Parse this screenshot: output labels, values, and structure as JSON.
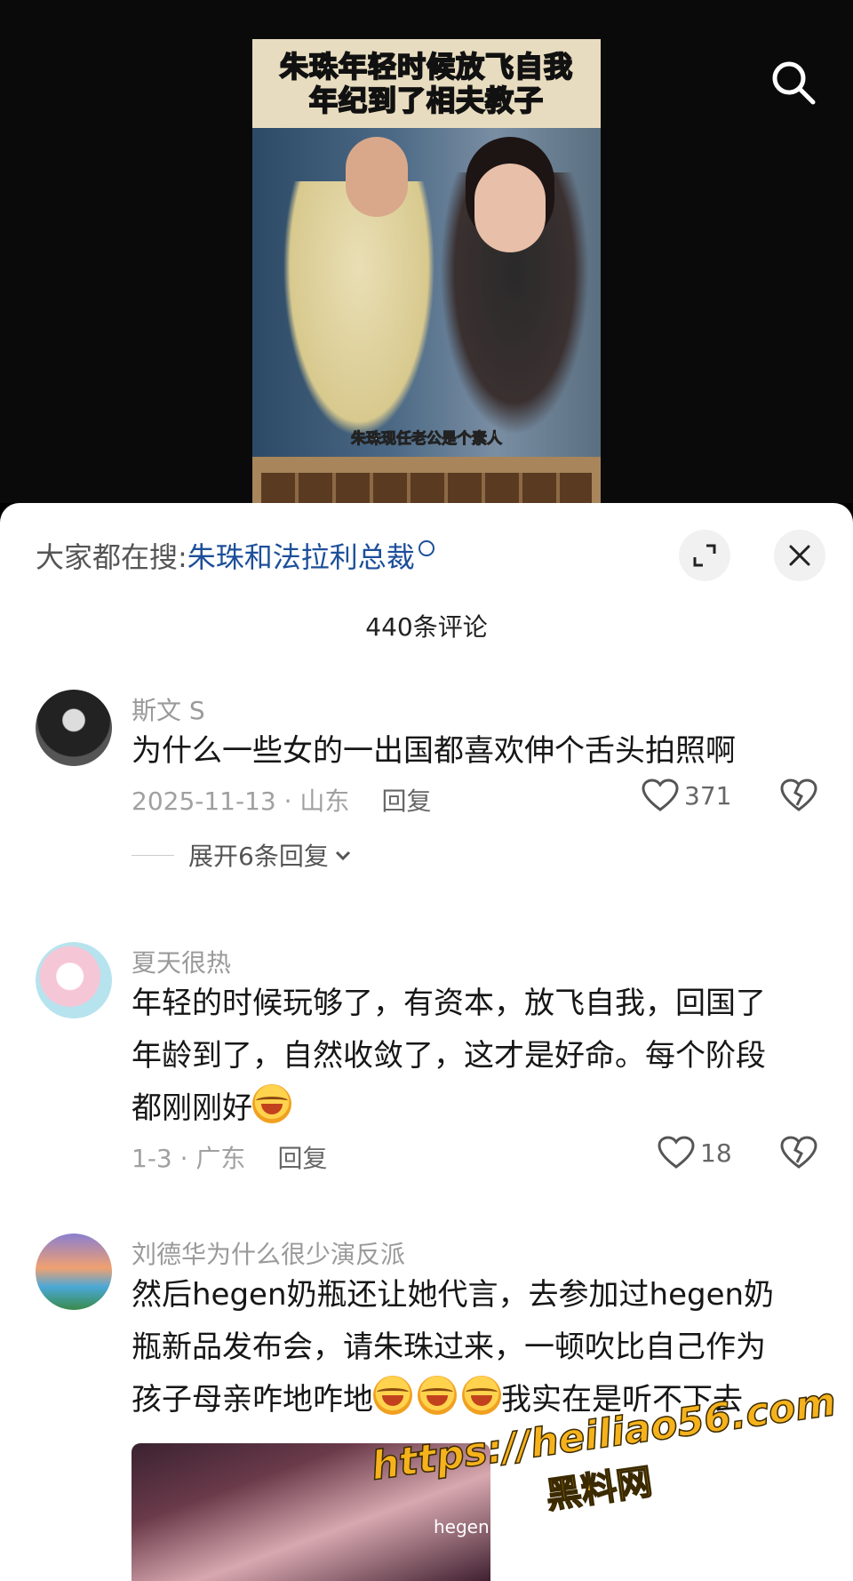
{
  "video": {
    "caption_line1": "朱珠年轻时候放飞自我",
    "caption_line2": "年纪到了相夫教子",
    "subtitle": "朱珠现任老公是个素人"
  },
  "sheet": {
    "hot_search_prefix": "大家都在搜:",
    "hot_search_link": "朱珠和法拉利总裁",
    "comment_count": "440条评论"
  },
  "comments": [
    {
      "user": "斯文 S",
      "text": "为什么一些女的一出国都喜欢伸个舌头拍照啊",
      "meta": "2025-11-13 · 山东",
      "reply": "回复",
      "likes": "371",
      "expand": "展开6条回复"
    },
    {
      "user": "夏天很热",
      "text_lines": [
        "年轻的时候玩够了，有资本，放飞自我，回国了",
        "年龄到了，自然收敛了，这才是好命。每个阶段",
        "都刚刚好"
      ],
      "meta": "1-3 · 广东",
      "reply": "回复",
      "likes": "18"
    },
    {
      "user": "刘德华为什么很少演反派",
      "text_lines": [
        "然后hegen奶瓶还让她代言，去参加过hegen奶",
        "瓶新品发布会，请朱珠过来，一顿吹比自己作为",
        "孩子母亲咋地咋地",
        "我实在是听不下去"
      ],
      "photo_text": "hegen"
    }
  ],
  "watermark": {
    "line1": "https://heiliao56.com",
    "line2": "黑料网"
  },
  "icons": [
    "search-icon",
    "expand-icon",
    "close-icon",
    "heart-icon",
    "broken-heart-icon",
    "chevron-down-icon",
    "laughing-emoji-icon"
  ]
}
